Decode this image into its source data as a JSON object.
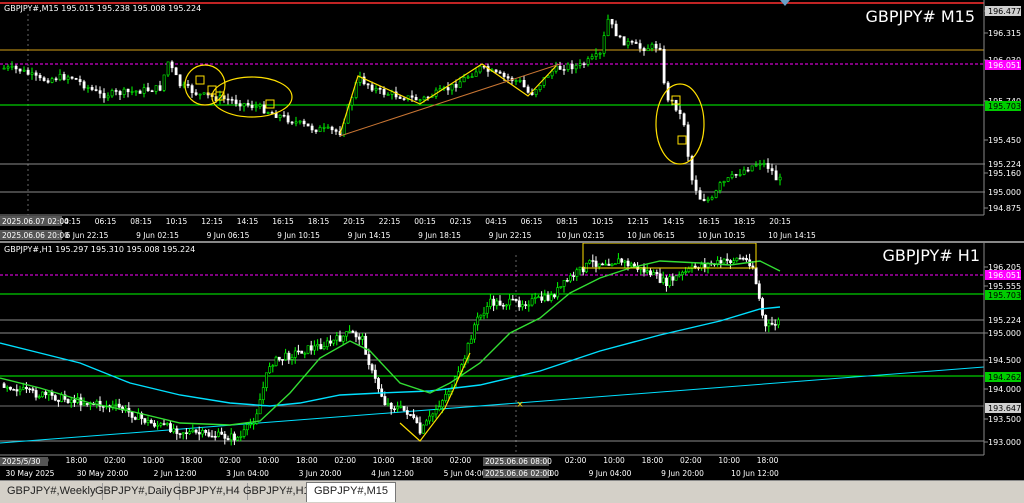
{
  "colors": {
    "background": "#000000",
    "bull": "#00ff00",
    "bear": "#ffffff",
    "grid": "#3a3a3a",
    "text": "#ffffff",
    "magenta": "#ff00ff",
    "green_line": "#00ff00",
    "orange_line": "#d4a017",
    "yellow_drawing": "#ffe000",
    "ma_cyan": "#00e0ff",
    "ma_green": "#33dd33",
    "trend_brown": "#c87533",
    "red_line": "#ff3030",
    "label_green_bg": "#00cc00",
    "label_magenta_bg": "#ff00ff"
  },
  "top_chart": {
    "info": "GBPJPY#,M15  195.015 195.238 195.008 195.224",
    "watermark": "GBPJPY# M15",
    "price_labels": [
      "196.477",
      "196.315",
      "196.030",
      "195.740",
      "195.450",
      "195.160",
      "195.224",
      "195.000",
      "194.875"
    ],
    "level_tags": {
      "magenta": "196.051",
      "green": "195.703",
      "white": "195.224",
      "white2": "195.000"
    },
    "time_labels": [
      "04:15",
      "06:15",
      "08:15",
      "10:15",
      "12:15",
      "14:15",
      "16:15",
      "18:15",
      "20:15",
      "22:15",
      "00:15",
      "02:15",
      "04:15",
      "06:15",
      "08:15",
      "10:15",
      "12:15",
      "14:15",
      "16:15",
      "18:15",
      "20:15"
    ],
    "date_labels": [
      "6 Jun 22:15",
      "9 Jun 02:15",
      "9 Jun 06:15",
      "9 Jun 10:15",
      "9 Jun 14:15",
      "9 Jun 18:15",
      "9 Jun 22:15",
      "10 Jun 02:15",
      "10 Jun 06:15",
      "10 Jun 10:15",
      "10 Jun 14:15"
    ],
    "highlight_top": "2025.06.07 02:00",
    "highlight_bottom": "2025.06.06 20:00"
  },
  "bottom_chart": {
    "info": "GBPJPY#,H1  195.297 195.310 195.008 195.224",
    "watermark": "GBPJPY# H1",
    "price_labels": [
      "196.205",
      "195.555",
      "195.000",
      "194.500",
      "194.000",
      "193.500",
      "193.000"
    ],
    "level_tags": {
      "magenta": "196.051",
      "green": "195.703",
      "white": "195.224",
      "green2": "194.262",
      "gray": "193.647"
    },
    "time_labels": [
      "10:00",
      "18:00",
      "02:00",
      "10:00",
      "18:00",
      "02:00",
      "10:00",
      "18:00",
      "02:00",
      "10:00",
      "18:00",
      "02:00",
      "10:00",
      "18:00",
      "02:00",
      "10:00",
      "18:00",
      "02:00",
      "10:00",
      "18:00"
    ],
    "date_labels": [
      "30 May 2025",
      "30 May 20:00",
      "2 Jun 12:00",
      "3 Jun 04:00",
      "3 Jun 20:00",
      "4 Jun 12:00",
      "5 Jun 04:00",
      "6 Jun 12:00",
      "9 Jun 04:00",
      "9 Jun 20:00",
      "10 Jun 12:00"
    ],
    "highlight_top": "2025/5/30",
    "highlight_mid_top": "2025.06.06 08:00",
    "highlight_mid_bottom": "2025.06.06 02:00"
  },
  "tabs": [
    {
      "label": "GBPJPY#,Weekly",
      "active": false
    },
    {
      "label": "GBPJPY#,Daily",
      "active": false
    },
    {
      "label": "GBPJPY#,H4",
      "active": false
    },
    {
      "label": "GBPJPY#,H1",
      "active": false
    },
    {
      "label": "GBPJPY#,M15",
      "active": true
    }
  ]
}
